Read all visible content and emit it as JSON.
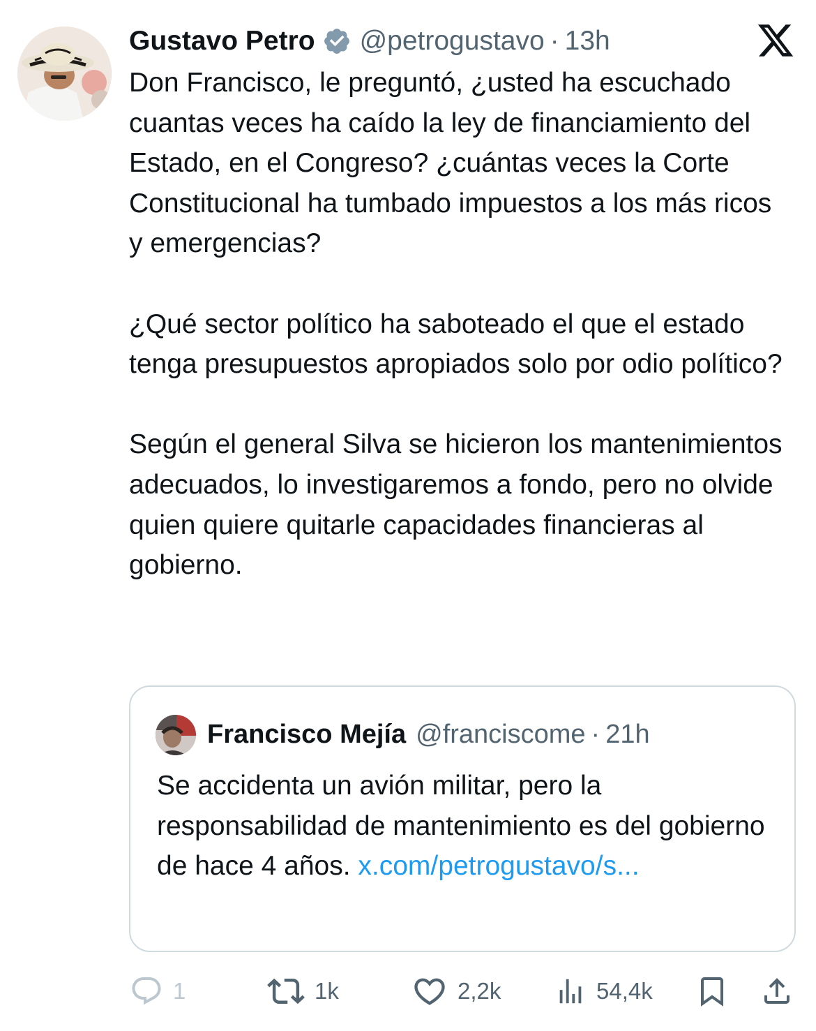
{
  "tweet": {
    "author_name": "Gustavo Petro",
    "author_handle": "@petrogustavo",
    "separator": "·",
    "time": "13h",
    "paragraphs": [
      "Don Francisco, le preguntó, ¿usted ha escuchado cuantas veces ha caído la ley de financiamiento del Estado, en el Congreso? ¿cuántas veces la Corte Constitucional ha tumbado impuestos a los más ricos y emergencias?",
      "¿Qué sector político ha saboteado el que el estado tenga presupuestos apropiados solo por odio político?",
      "Según el general Silva se hicieron los mantenimientos adecuados, lo investigaremos a fondo, pero no olvide quien quiere quitarle capacidades financieras al gobierno."
    ]
  },
  "quoted": {
    "author_name": "Francisco Mejía",
    "author_handle": "@franciscome",
    "separator": "·",
    "time": "21h",
    "text": "Se accidenta un avión militar, pero la responsabilidad de mantenimiento es del gobierno de hace 4 años.",
    "link_text": "x.com/petrogustavo/s..."
  },
  "actions": {
    "replies": "1",
    "retweets": "1k",
    "likes": "2,2k",
    "views": "54,4k"
  },
  "icons": {
    "platform": "x-logo-icon",
    "verified": "verified-badge-icon",
    "reply": "reply-icon",
    "retweet": "retweet-icon",
    "like": "heart-icon",
    "views": "views-icon",
    "bookmark": "bookmark-icon",
    "share": "share-icon"
  },
  "colors": {
    "text": "#0f1419",
    "secondary": "#536471",
    "link": "#1d9bf0",
    "verified": "#829aab",
    "border": "#cfd9de"
  }
}
